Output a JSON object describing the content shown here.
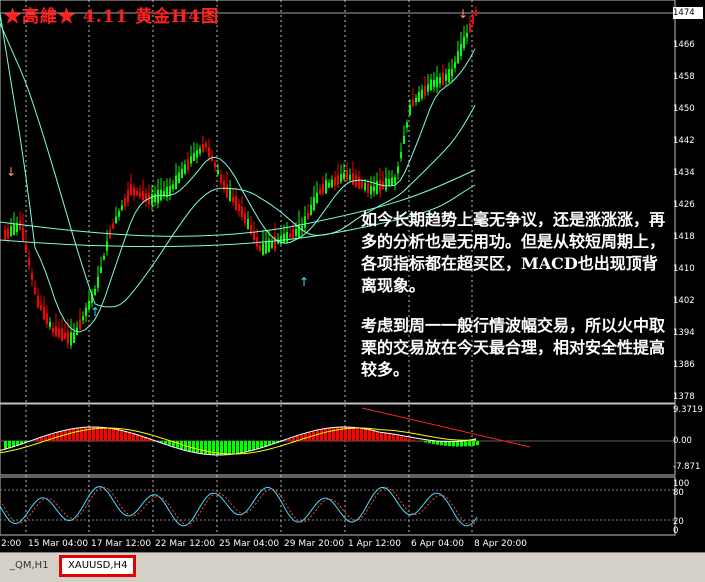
{
  "header": {
    "title": "★高維★ 4.11 黄金H4图"
  },
  "annotation": {
    "paragraph1": "如今长期趋势上毫无争议，还是涨涨涨，再多的分析也是无用功。但是从较短周期上，各项指标都在超买区，MACD也出现顶背离现象。",
    "paragraph2": "考虑到周一一般行情波幅交易，所以火中取栗的交易放在今天最合理，相对安全性提高较多。"
  },
  "price_axis": {
    "labels": [
      "1474",
      "1466",
      "1458",
      "1450",
      "1442",
      "1434",
      "1426",
      "1418",
      "1410",
      "1402",
      "1394",
      "1386",
      "1378"
    ],
    "current_price": "1474"
  },
  "macd_axis": {
    "labels": [
      "9.3719",
      "0.00",
      "-7.871"
    ]
  },
  "rsi_axis": {
    "labels": [
      "100",
      "80",
      "20",
      "0"
    ]
  },
  "time_axis": {
    "labels": [
      "2:00",
      "15 Mar 04:00",
      "17 Mar 12:00",
      "22 Mar 12:00",
      "25 Mar 04:00",
      "29 Mar 20:00",
      "1 Apr 12:00",
      "6 Apr 04:00",
      "8 Apr 20:00"
    ]
  },
  "tabs": [
    {
      "label": "_QM,H1",
      "active": false
    },
    {
      "label": "XAUUSD,H4",
      "active": true
    }
  ],
  "colors": {
    "bull": "#00ff00",
    "bear": "#ff0000",
    "background": "#000000",
    "title": "#ff2020",
    "ma": "#7fffd4",
    "signal": "#ffff00"
  },
  "icons": {
    "sell_arrow": "arrow-down-icon",
    "buy_arrow": "arrow-up-icon"
  }
}
